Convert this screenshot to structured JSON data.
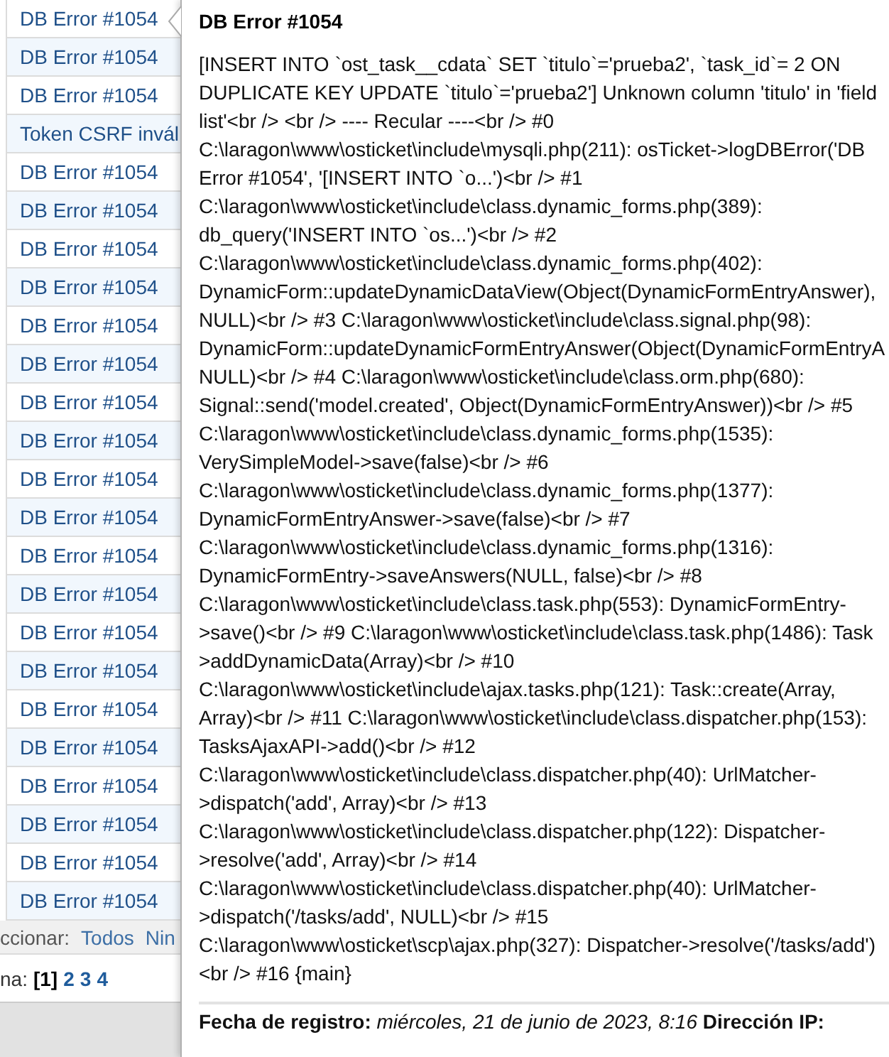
{
  "table": {
    "rows": [
      {
        "subject": "DB Error #1054"
      },
      {
        "subject": "DB Error #1054"
      },
      {
        "subject": "DB Error #1054"
      },
      {
        "subject": "Token CSRF invál"
      },
      {
        "subject": "DB Error #1054"
      },
      {
        "subject": "DB Error #1054"
      },
      {
        "subject": "DB Error #1054"
      },
      {
        "subject": "DB Error #1054"
      },
      {
        "subject": "DB Error #1054"
      },
      {
        "subject": "DB Error #1054"
      },
      {
        "subject": "DB Error #1054"
      },
      {
        "subject": "DB Error #1054"
      },
      {
        "subject": "DB Error #1054"
      },
      {
        "subject": "DB Error #1054"
      },
      {
        "subject": "DB Error #1054"
      },
      {
        "subject": "DB Error #1054"
      },
      {
        "subject": "DB Error #1054"
      },
      {
        "subject": "DB Error #1054"
      },
      {
        "subject": "DB Error #1054"
      },
      {
        "subject": "DB Error #1054"
      },
      {
        "subject": "DB Error #1054"
      },
      {
        "subject": "DB Error #1054"
      },
      {
        "subject": "DB Error #1054"
      },
      {
        "subject": "DB Error #1054"
      }
    ]
  },
  "selection": {
    "label": "ccionar:",
    "links": [
      "Todos",
      "Nin"
    ]
  },
  "pagination": {
    "label": "na:",
    "pages": [
      {
        "label": "[1]",
        "selected": true
      },
      {
        "label": "2",
        "selected": false
      },
      {
        "label": "3",
        "selected": false
      },
      {
        "label": "4",
        "selected": false
      }
    ]
  },
  "popup": {
    "title": "DB Error #1054",
    "lines": [
      "[INSERT INTO `ost_task__cdata` SET `titulo`='prueba2', `task_id`= 2 ON",
      "DUPLICATE KEY UPDATE `titulo`='prueba2'] Unknown column 'titulo' in 'field",
      "list'<br /> <br /> ---- Recular ----<br /> #0",
      "C:\\laragon\\www\\osticket\\include\\mysqli.php(211): osTicket->logDBError('DB",
      "Error #1054', '[INSERT INTO `o...')<br /> #1",
      "C:\\laragon\\www\\osticket\\include\\class.dynamic_forms.php(389):",
      "db_query('INSERT INTO `os...')<br /> #2",
      "C:\\laragon\\www\\osticket\\include\\class.dynamic_forms.php(402):",
      "DynamicForm::updateDynamicDataView(Object(DynamicFormEntryAnswer),",
      "NULL)<br /> #3 C:\\laragon\\www\\osticket\\include\\class.signal.php(98):",
      "DynamicForm::updateDynamicFormEntryAnswer(Object(DynamicFormEntryA",
      "NULL)<br /> #4 C:\\laragon\\www\\osticket\\include\\class.orm.php(680):",
      "Signal::send('model.created', Object(DynamicFormEntryAnswer))<br /> #5",
      "C:\\laragon\\www\\osticket\\include\\class.dynamic_forms.php(1535):",
      "VerySimpleModel->save(false)<br /> #6",
      "C:\\laragon\\www\\osticket\\include\\class.dynamic_forms.php(1377):",
      "DynamicFormEntryAnswer->save(false)<br /> #7",
      "C:\\laragon\\www\\osticket\\include\\class.dynamic_forms.php(1316):",
      "DynamicFormEntry->saveAnswers(NULL, false)<br /> #8",
      "C:\\laragon\\www\\osticket\\include\\class.task.php(553): DynamicFormEntry-",
      ">save()<br /> #9 C:\\laragon\\www\\osticket\\include\\class.task.php(1486): Task",
      ">addDynamicData(Array)<br /> #10",
      "C:\\laragon\\www\\osticket\\include\\ajax.tasks.php(121): Task::create(Array,",
      "Array)<br /> #11 C:\\laragon\\www\\osticket\\include\\class.dispatcher.php(153):",
      "TasksAjaxAPI->add()<br /> #12",
      "C:\\laragon\\www\\osticket\\include\\class.dispatcher.php(40): UrlMatcher-",
      ">dispatch('add', Array)<br /> #13",
      "C:\\laragon\\www\\osticket\\include\\class.dispatcher.php(122): Dispatcher-",
      ">resolve('add', Array)<br /> #14",
      "C:\\laragon\\www\\osticket\\include\\class.dispatcher.php(40): UrlMatcher-",
      ">dispatch('/tasks/add', NULL)<br /> #15",
      "C:\\laragon\\www\\osticket\\scp\\ajax.php(327): Dispatcher->resolve('/tasks/add')",
      "<br /> #16 {main}"
    ],
    "footer": "**Fecha de registro:** *miércoles, 21 de junio de 2023, 8:16* **Dirección IP:**"
  }
}
